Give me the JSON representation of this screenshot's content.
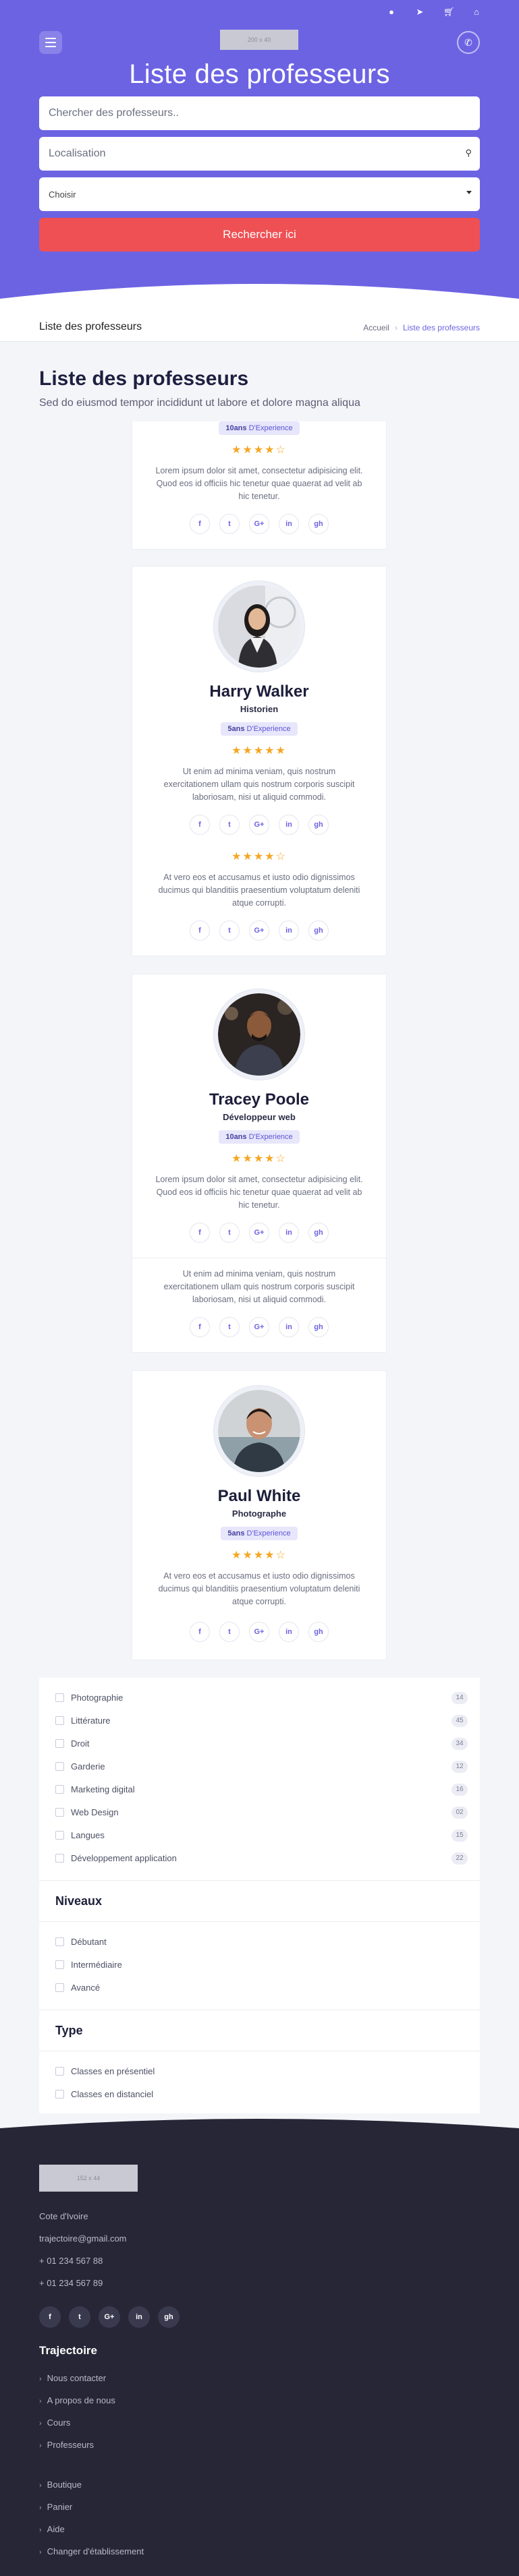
{
  "header": {
    "top_icons": [
      "user-icon",
      "sign-in-icon",
      "cart-icon",
      "home-icon"
    ],
    "logo_text": "200 x 40",
    "title": "Liste des professeurs"
  },
  "search": {
    "keyword_placeholder": "Chercher des professeurs..",
    "location_placeholder": "Localisation",
    "select_value": "Choisir",
    "button_label": "Rechercher ici"
  },
  "breadcrumb": {
    "page_title": "Liste des professeurs",
    "home": "Accueil",
    "separator": "›",
    "current": "Liste des professeurs"
  },
  "page": {
    "title": "Liste des professeurs",
    "subtitle": "Sed do eiusmod tempor incididunt ut labore et dolore magna aliqua"
  },
  "cards": {
    "partial": {
      "badge_years": "10ans",
      "badge_text": "D'Experience",
      "stars": "★★★★☆",
      "description": "Lorem ipsum dolor sit amet, consectetur adipisicing elit. Quod eos id officiis hic tenetur quae quaerat ad velit ab hic tenetur."
    },
    "harry": {
      "name": "Harry Walker",
      "role": "Historien",
      "badge_years": "5ans",
      "badge_text": "D'Experience",
      "stars": "★★★★★",
      "description": "Ut enim ad minima veniam, quis nostrum exercitationem ullam quis nostrum corporis suscipit laboriosam, nisi ut aliquid commodi.",
      "sub_stars": "★★★★☆",
      "sub_description": "At vero eos et accusamus et iusto odio dignissimos ducimus qui blanditiis praesentium voluptatum deleniti atque corrupti."
    },
    "tracey": {
      "name": "Tracey Poole",
      "role": "Développeur web",
      "badge_years": "10ans",
      "badge_text": "D'Experience",
      "stars": "★★★★☆",
      "description": "Lorem ipsum dolor sit amet, consectetur adipisicing elit. Quod eos id officiis hic tenetur quae quaerat ad velit ab hic tenetur.",
      "sub_description": "Ut enim ad minima veniam, quis nostrum exercitationem ullam quis nostrum corporis suscipit laboriosam, nisi ut aliquid commodi."
    },
    "paul": {
      "name": "Paul White",
      "role": "Photographe",
      "badge_years": "5ans",
      "badge_text": "D'Experience",
      "stars": "★★★★☆",
      "description": "At vero eos et accusamus et iusto odio dignissimos ducimus qui blanditiis praesentium voluptatum deleniti atque corrupti."
    },
    "social_labels": [
      "f",
      "t",
      "G+",
      "in",
      "gh"
    ]
  },
  "filters": {
    "categories": [
      {
        "label": "Photographie",
        "count": "14"
      },
      {
        "label": "Littérature",
        "count": "45"
      },
      {
        "label": "Droit",
        "count": "34"
      },
      {
        "label": "Garderie",
        "count": "12"
      },
      {
        "label": "Marketing digital",
        "count": "16"
      },
      {
        "label": "Web Design",
        "count": "02"
      },
      {
        "label": "Langues",
        "count": "15"
      },
      {
        "label": "Développement application",
        "count": "22"
      }
    ],
    "levels_title": "Niveaux",
    "levels": [
      "Débutant",
      "Intermédiaire",
      "Avancé"
    ],
    "type_title": "Type",
    "types": [
      "Classes en présentiel",
      "Classes en distanciel"
    ]
  },
  "footer": {
    "logo_text": "152 x 44",
    "address": "Cote d'Ivoire",
    "email": "trajectoire@gmail.com",
    "phone1": "+ 01 234 567 88",
    "phone2": "+ 01 234 567 89",
    "social_labels": [
      "f",
      "t",
      "G+",
      "in",
      "gh"
    ],
    "section_title": "Trajectoire",
    "links1": [
      "Nous contacter",
      "A propos de nous",
      "Cours",
      "Professeurs"
    ],
    "links2": [
      "Boutique",
      "Panier",
      "Aide",
      "Changer d'établissement"
    ]
  },
  "colors": {
    "brand": "#6c63e3",
    "accent": "#ef5054",
    "star": "#f5a623",
    "footer_bg": "#262637"
  }
}
